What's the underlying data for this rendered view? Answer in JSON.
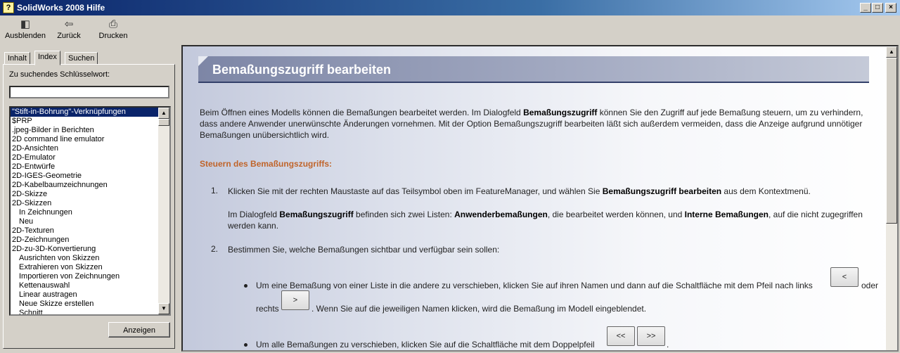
{
  "window": {
    "title": "SolidWorks 2008 Hilfe",
    "minimize": "_",
    "restore": "□",
    "close": "×"
  },
  "toolbar": {
    "hide": "Ausblenden",
    "back": "Zurück",
    "print": "Drucken"
  },
  "tabs": {
    "contents": "Inhalt",
    "index": "Index",
    "search": "Suchen"
  },
  "index_panel": {
    "keyword_label": "Zu suchendes Schlüsselwort:",
    "keyword_value": "",
    "show_button": "Anzeigen",
    "items": [
      {
        "text": "\"Stift-in-Bohrung\"-Verknüpfungen",
        "selected": true,
        "sub": false
      },
      {
        "text": "$PRP",
        "selected": false,
        "sub": false
      },
      {
        "text": ".jpeg-Bilder in Berichten",
        "selected": false,
        "sub": false
      },
      {
        "text": "2D command line emulator",
        "selected": false,
        "sub": false
      },
      {
        "text": "2D-Ansichten",
        "selected": false,
        "sub": false
      },
      {
        "text": "2D-Emulator",
        "selected": false,
        "sub": false
      },
      {
        "text": "2D-Entwürfe",
        "selected": false,
        "sub": false
      },
      {
        "text": "2D-IGES-Geometrie",
        "selected": false,
        "sub": false
      },
      {
        "text": "2D-Kabelbaumzeichnungen",
        "selected": false,
        "sub": false
      },
      {
        "text": "2D-Skizze",
        "selected": false,
        "sub": false
      },
      {
        "text": "2D-Skizzen",
        "selected": false,
        "sub": false
      },
      {
        "text": "In Zeichnungen",
        "selected": false,
        "sub": true
      },
      {
        "text": "Neu",
        "selected": false,
        "sub": true
      },
      {
        "text": "2D-Texturen",
        "selected": false,
        "sub": false
      },
      {
        "text": "2D-Zeichnungen",
        "selected": false,
        "sub": false
      },
      {
        "text": "2D-zu-3D-Konvertierung",
        "selected": false,
        "sub": false
      },
      {
        "text": "Ausrichten von Skizzen",
        "selected": false,
        "sub": true
      },
      {
        "text": "Extrahieren von Skizzen",
        "selected": false,
        "sub": true
      },
      {
        "text": "Importieren von Zeichnungen",
        "selected": false,
        "sub": true
      },
      {
        "text": "Kettenauswahl",
        "selected": false,
        "sub": true
      },
      {
        "text": "Linear austragen",
        "selected": false,
        "sub": true
      },
      {
        "text": "Neue Skizze erstellen",
        "selected": false,
        "sub": true
      },
      {
        "text": "Schnitt",
        "selected": false,
        "sub": true
      }
    ]
  },
  "topic": {
    "title": "Bemaßungszugriff bearbeiten",
    "intro_1": "Beim Öffnen eines Modells können die Bemaßungen bearbeitet werden. Im Dialogfeld ",
    "intro_b": "Bemaßungszugriff",
    "intro_2": " können Sie den Zugriff auf jede Bemaßung steuern, um zu verhindern, dass andere Anwender unerwünschte Änderungen vornehmen. Mit der Option Bemaßungszugriff bearbeiten läßt sich außerdem vermeiden, dass die Anzeige aufgrund unnötiger Bemaßungen unübersichtlich wird.",
    "section": "Steuern des Bemaßungszugriffs:",
    "step1_num": "1.",
    "step1_a": "Klicken Sie mit der rechten Maustaste auf das Teilsymbol oben im FeatureManager, und wählen Sie ",
    "step1_b": "Bemaßungszugriff bearbeiten",
    "step1_c": " aus dem Kontextmenü.",
    "step1_p2_a": "Im Dialogfeld ",
    "step1_p2_b": "Bemaßungszugriff",
    "step1_p2_c": " befinden sich zwei Listen: ",
    "step1_p2_d": "Anwenderbemaßungen",
    "step1_p2_e": ", die bearbeitet werden können, und ",
    "step1_p2_f": "Interne Bemaßungen",
    "step1_p2_g": ", auf die nicht zugegriffen werden kann.",
    "step2_num": "2.",
    "step2": "Bestimmen Sie, welche Bemaßungen sichtbar und verfügbar sein sollen:",
    "bullet1_a": "Um eine Bemaßung von einer Liste in die andere zu verschieben, klicken Sie auf ihren Namen und dann auf die Schaltfläche mit dem Pfeil nach links",
    "bullet1_or": "oder",
    "bullet1_right": "rechts",
    "bullet1_b": ". Wenn Sie auf die jeweiligen Namen klicken, wird die Bemaßung im Modell eingeblendet.",
    "bullet2_a": "Um alle Bemaßungen zu verschieben, klicken Sie auf die Schaltfläche mit dem Doppelpfeil",
    "bullet2_end": ".",
    "btn_left": "<",
    "btn_right": ">",
    "btn_dleft": "<<",
    "btn_dright": ">>"
  },
  "icons": {
    "app": "?",
    "hide": "◧",
    "back": "⇦",
    "print": "⎙",
    "scroll_up": "▲",
    "scroll_down": "▼"
  }
}
